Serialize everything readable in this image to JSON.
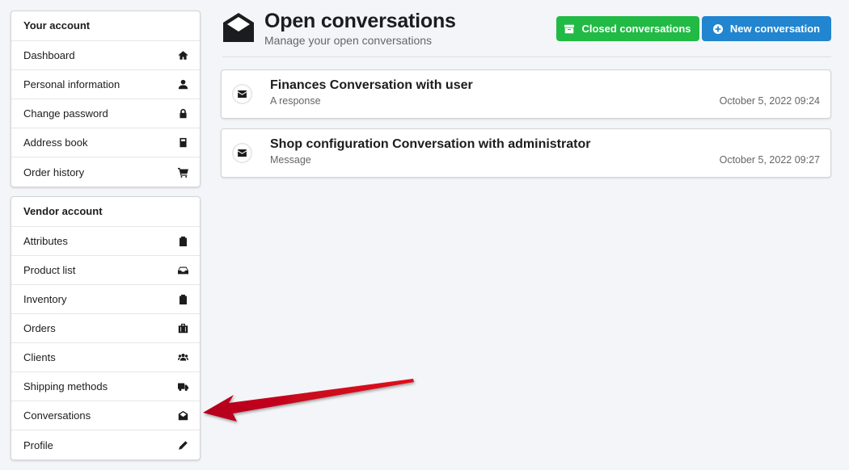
{
  "sidebar": {
    "account": {
      "header": "Your account",
      "items": [
        {
          "label": "Dashboard",
          "icon": "home-icon"
        },
        {
          "label": "Personal information",
          "icon": "user-icon"
        },
        {
          "label": "Change password",
          "icon": "lock-icon"
        },
        {
          "label": "Address book",
          "icon": "address-book-icon"
        },
        {
          "label": "Order history",
          "icon": "cart-icon"
        }
      ]
    },
    "vendor": {
      "header": "Vendor account",
      "items": [
        {
          "label": "Attributes",
          "icon": "clipboard-icon"
        },
        {
          "label": "Product list",
          "icon": "inbox-icon"
        },
        {
          "label": "Inventory",
          "icon": "clipboard-icon"
        },
        {
          "label": "Orders",
          "icon": "briefcase-icon"
        },
        {
          "label": "Clients",
          "icon": "users-icon"
        },
        {
          "label": "Shipping methods",
          "icon": "truck-icon"
        },
        {
          "label": "Conversations",
          "icon": "envelope-open-icon"
        },
        {
          "label": "Profile",
          "icon": "pencil-icon"
        }
      ]
    }
  },
  "header": {
    "title": "Open conversations",
    "subtitle": "Manage your open conversations",
    "icon": "envelope-open-icon",
    "closed_button": "Closed conversations",
    "new_button": "New conversation"
  },
  "conversations": [
    {
      "title": "Finances Conversation with user",
      "snippet": "A response",
      "date": "October 5, 2022 09:24"
    },
    {
      "title": "Shop configuration Conversation with administrator",
      "snippet": "Message",
      "date": "October 5, 2022 09:27"
    }
  ],
  "colors": {
    "closed_button": "#21ba45",
    "new_button": "#2185d0",
    "annotation_arrow": "#d0021b"
  }
}
